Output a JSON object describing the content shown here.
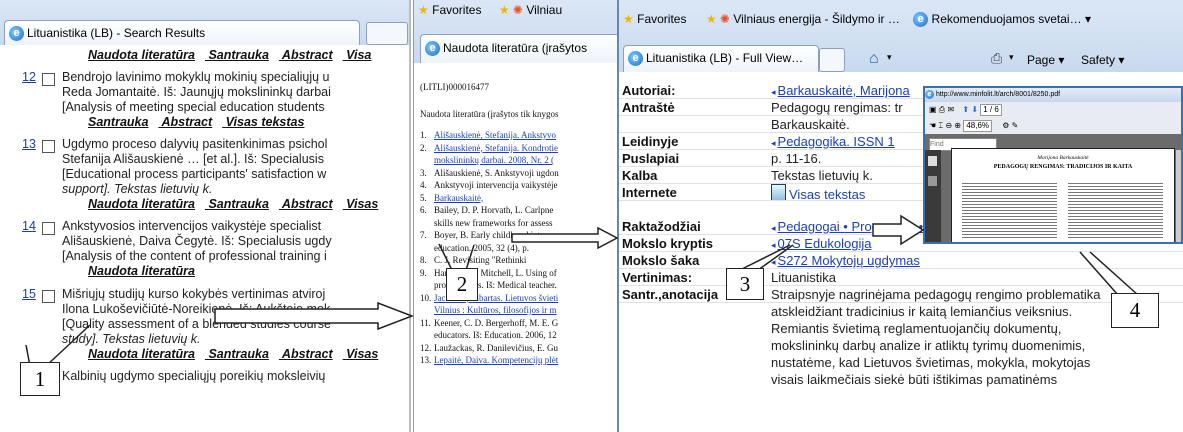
{
  "window1": {
    "tab_title": "Lituanistika (LB) - Search Results",
    "top_links": [
      "Naudota literatūra",
      "Santrauka",
      "Abstract",
      "Visa"
    ],
    "results": [
      {
        "num": "12",
        "lines": [
          "Bendrojo lavinimo mokyklų mokinių specialiųjų u",
          "Reda Jomantaitė. Iš: Jaunųjų mokslininkų darbai",
          "[Analysis of meeting special education students"
        ],
        "links": [
          "Santrauka",
          "Abstract",
          "Visas tekstas"
        ]
      },
      {
        "num": "13",
        "lines": [
          "Ugdymo proceso dalyvių pasitenkinimas psichol",
          "Stefanija Ališauskienė … [et al.]. Iš: Specialusis",
          "[Educational process participants' satisfaction w",
          "support]. Tekstas lietuvių  k."
        ],
        "links": [
          "Naudota literatūra",
          "Santrauka",
          "Abstract",
          "Visas"
        ]
      },
      {
        "num": "14",
        "lines": [
          "Ankstyvosios intervencijos vaikystėje specialist",
          "Ališauskienė, Daiva Čegytė. Iš: Specialusis ugdy",
          "[Analysis of the content of professional training i"
        ],
        "links": [
          "Naudota literatūra"
        ]
      },
      {
        "num": "15",
        "lines": [
          "Mišriųjų studijų kurso kokybės vertinimas atviroj",
          "Ilona Lukoševičiūtė-Noreikienė. Iš: Aukštojo mok",
          "[Quality assessment of a blended studies course",
          "study]. Tekstas lietuvių  k."
        ],
        "links": [
          "Naudota literatūra",
          "Santrauka",
          "Abstract",
          "Visas"
        ]
      },
      {
        "num": "16",
        "lines": [
          "Kalbinių ugdymo specialiųjų poreikių moksleivių"
        ],
        "links": []
      }
    ]
  },
  "window2": {
    "favorites": "Favorites",
    "vilniaus_short": "Vilniau",
    "tab_title": "Naudota literatūra (įrašytos",
    "doc_id": "(LITLI)000016477",
    "doc_heading": "Naudota literatūra (įrašytos tik knygos",
    "refs": [
      {
        "n": "1.",
        "t": "Ališauskienė, Stefanija. Ankstyvo",
        "link": true
      },
      {
        "n": "2.",
        "t": "Ališauskienė, Stefanija. Kondrotie",
        "link": true
      },
      {
        "n": "",
        "t": "mokslininkų darbai. 2008, Nr. 2 (",
        "link": true
      },
      {
        "n": "3.",
        "t": "Ališauskienė, S. Ankstyvoji ugdon",
        "link": false
      },
      {
        "n": "4.",
        "t": "Ankstyvoji intervencija vaikystėje",
        "link": false
      },
      {
        "n": "5.",
        "t": "Barkauskaitė,",
        "link": true
      },
      {
        "n": "6.",
        "t": "Bailey, D. P. Horvath, L. Carlpne",
        "link": false
      },
      {
        "n": "",
        "t": "skills new frameworks for assess",
        "link": false
      },
      {
        "n": "7.",
        "t": "Boyer, B. Early childhood inte",
        "link": false
      },
      {
        "n": "",
        "t": "education. 2005, 32 (4), p.",
        "link": false
      },
      {
        "n": "8.",
        "t": "C. J. Revisiting \"Rethinki",
        "link": false
      },
      {
        "n": "9.",
        "t": "Harrison, R. Mitchell, L. Using of",
        "link": false
      },
      {
        "n": "",
        "t": "professionals. Iš: Medical teacher.",
        "link": false
      },
      {
        "n": "10.",
        "t": "Jackūnas, Žibartas. Lietuvos švieti",
        "link": true
      },
      {
        "n": "",
        "t": "Vilnius : Kultūros, filosofijos ir m",
        "link": true
      },
      {
        "n": "11.",
        "t": "Keener, C. D. Bergerhoff, M. E. G",
        "link": false
      },
      {
        "n": "",
        "t": "educators. Iš: Education. 2006, 12",
        "link": false
      },
      {
        "n": "12.",
        "t": "Laužackas, R. Danilevičius, E. Gu",
        "link": false
      },
      {
        "n": "13.",
        "t": "Lepaitė, Daiva. Kompetencijų plėt",
        "link": true
      }
    ]
  },
  "window3": {
    "favorites": "Favorites",
    "vilniaus": "Vilniaus energija - Šildymo ir …",
    "rekomenduojamos": "Rekomenduojamos svetai…",
    "tab_title": "Lituanistika (LB) - Full View…",
    "page_menu": "Page",
    "safety_menu": "Safety",
    "fields": [
      {
        "label": "Autoriai:",
        "value": "Barkauskaitė, Marijona",
        "link": true
      },
      {
        "label": "Antraštė",
        "value": "Pedagogų rengimas: tr",
        "link": false
      },
      {
        "label": "",
        "value": "Barkauskaitė.",
        "link": false
      },
      {
        "label": "Leidinyje",
        "value": "Pedagogika. ISSN 1",
        "link": true
      },
      {
        "label": "Puslapiai",
        "value": "p. 11-16.",
        "link": false
      },
      {
        "label": "Kalba",
        "value": "Tekstas lietuvių  k.",
        "link": false
      },
      {
        "label": "Internete",
        "value": "Visas tekstas",
        "link": true
      },
      {
        "label": "Raktažodžiai",
        "value": "Pedagogai • Programos • Tradicijos • Kaita • Kompetencija",
        "link": true
      },
      {
        "label": "Mokslo kryptis",
        "value": "07S Edukologija",
        "link": true
      },
      {
        "label": "Mokslo šaka",
        "value": "S272 Mokytojų ugdymas",
        "link": true
      },
      {
        "label": "Vertinimas:",
        "value": "Lituanistika",
        "link": false
      },
      {
        "label": "Santr.,anotacija",
        "value": "Straipsnyje nagrinėjama pedagogų rengimo problematika",
        "link": false
      }
    ],
    "abstract_lines": [
      "atskleidžiant tradicinius ir kaitą lemiančius veiksnius.",
      "Remiantis švietimą reglamentuojančių dokumentų,",
      "mokslininkų darbų analize ir atliktų tyrimų duomenimis,",
      "nustatėme, kad Lietuvos švietimas, mokykla, mokytojas",
      "visais laikmečiais siekė būti ištikimas pamatinėms"
    ]
  },
  "pdf_window": {
    "url": "http://www.minfolit.lt/arch/8001/8250.pdf",
    "zoom": "48,6%",
    "page_field": "1 / 6",
    "search_placeholder": "Find",
    "doc_author": "Marijona Barkauskaitė",
    "doc_title": "PEDAGOGŲ RENGIMAS: TRADICIJOS IR KAITA"
  },
  "callouts": [
    "1",
    "2",
    "3",
    "4"
  ]
}
